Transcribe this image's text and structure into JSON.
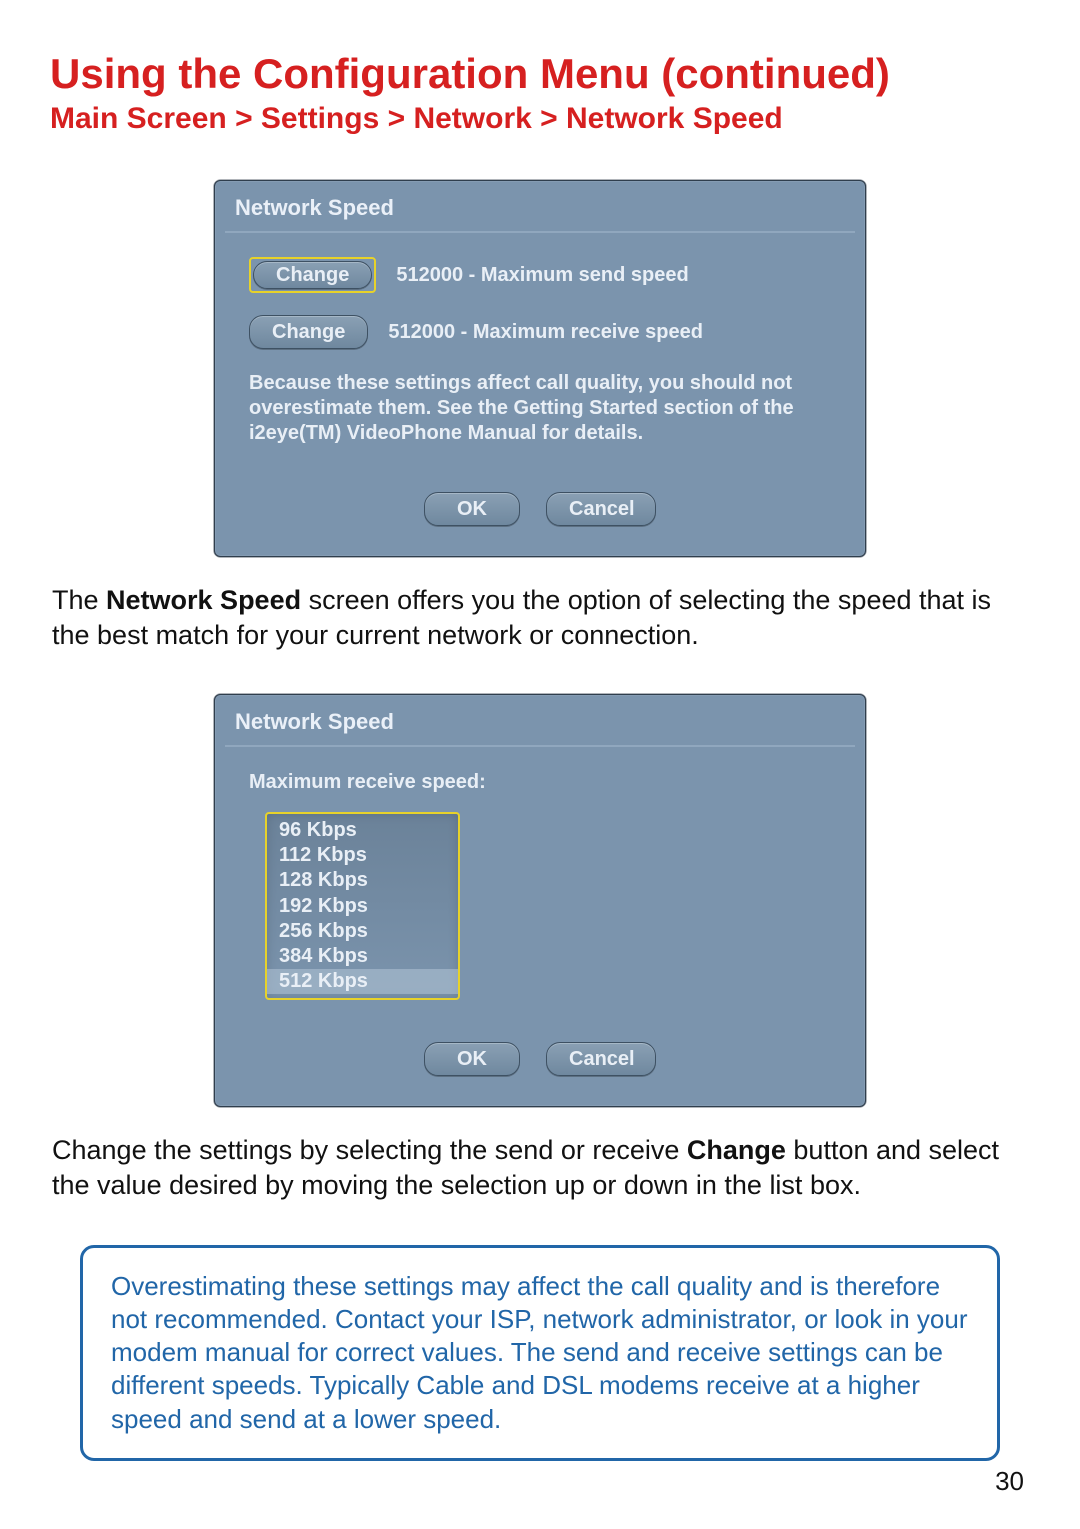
{
  "title": "Using the Configuration Menu (continued)",
  "breadcrumb": "Main Screen > Settings > Network > Network Speed",
  "dialog1": {
    "title": "Network Speed",
    "change_label": "Change",
    "send_text": "512000 - Maximum send speed",
    "receive_text": "512000 - Maximum receive speed",
    "note": "Because these settings affect call quality, you should not overestimate them.  See the Getting Started section of the i2eye(TM) VideoPhone Manual for details.",
    "ok_label": "OK",
    "cancel_label": "Cancel"
  },
  "para1_pre": "The ",
  "para1_bold": "Network Speed",
  "para1_post": " screen offers you the option of selecting the speed that is the best match for your current network or connection.",
  "dialog2": {
    "title": "Network Speed",
    "field_label": "Maximum receive speed:",
    "options": [
      "96 Kbps",
      "112 Kbps",
      "128 Kbps",
      "192 Kbps",
      "256 Kbps",
      "384 Kbps",
      "512 Kbps"
    ],
    "selected_index": 6,
    "ok_label": "OK",
    "cancel_label": "Cancel"
  },
  "para2_pre": "Change the settings by selecting the send or receive ",
  "para2_bold": "Change",
  "para2_post": " button and select the value desired by moving the selection up or down in the list box.",
  "note_box": "Overestimating these settings may affect the call quality and is therefore not recommended. Contact your ISP, network administrator, or look in your modem manual for correct values. The send and receive settings can be different speeds. Typically Cable and DSL modems receive at a higher speed and send at a lower speed.",
  "page_number": "30"
}
